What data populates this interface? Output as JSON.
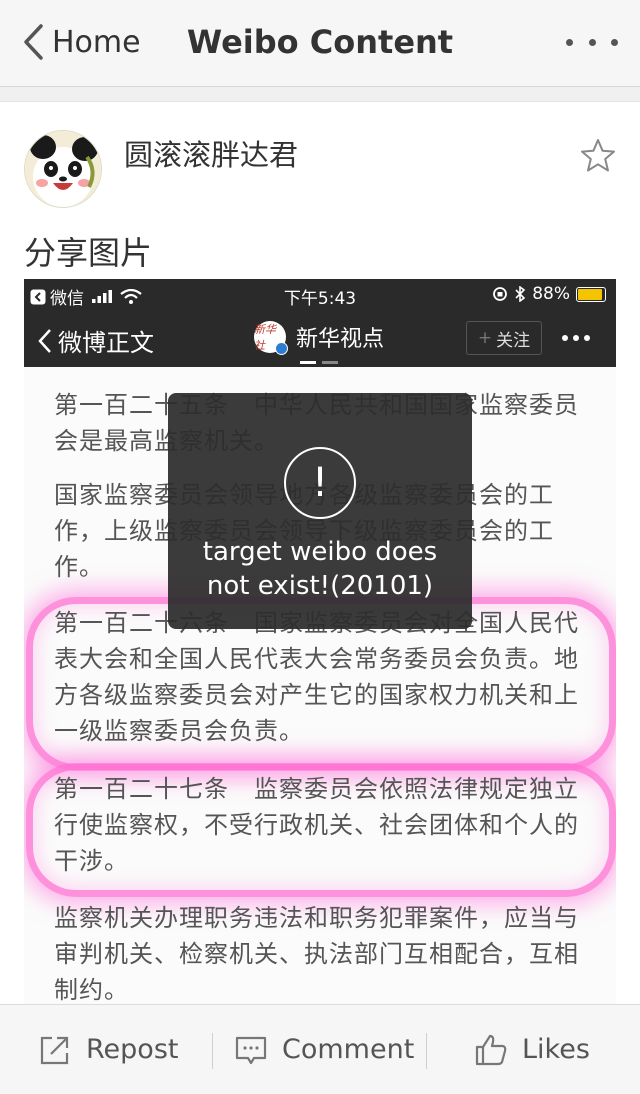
{
  "nav": {
    "back_label": "Home",
    "title": "Weibo Content"
  },
  "post": {
    "username": "圆滚滚胖达君",
    "text": "分享图片"
  },
  "embedded": {
    "status_bar": {
      "carrier": "微信",
      "time": "下午5:43",
      "battery": "88%"
    },
    "nav": {
      "back_label": "微博正文",
      "account": "新华视点",
      "follow_label": "关注",
      "logo_text": "新华社"
    },
    "paragraphs": [
      "第一百二十五条　中华人民共和国国家监察委员会是最高监察机关。",
      "国家监察委员会领导地方各级监察委员会的工作，上级监察委员会领导下级监察委员会的工作。",
      "第一百二十六条　国家监察委员会对全国人民代表大会和全国人民代表大会常务委员会负责。地方各级监察委员会对产生它的国家权力机关和上一级监察委员会负责。",
      "第一百二十七条　监察委员会依照法律规定独立行使监察权，不受行政机关、社会团体和个人的干涉。",
      "监察机关办理职务违法和职务犯罪案件，应当与审判机关、检察机关、执法部门互相配合，互相制约。"
    ]
  },
  "toast": {
    "icon": "!",
    "message": "target weibo does not exist!(20101)"
  },
  "bottom": {
    "repost": "Repost",
    "comment": "Comment",
    "likes": "Likes"
  }
}
